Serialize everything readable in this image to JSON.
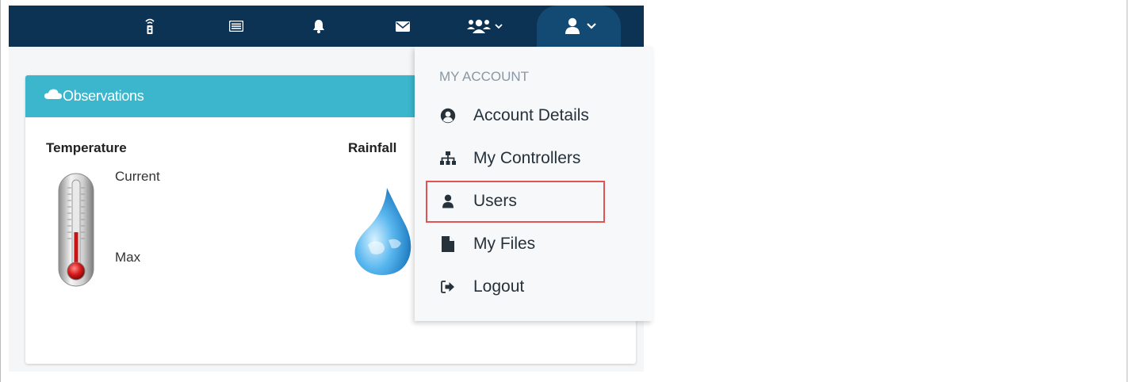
{
  "navbar": {
    "icons": [
      "remote-control-icon",
      "list-icon",
      "bell-icon",
      "envelope-icon",
      "users-icon",
      "user-icon"
    ],
    "background": "#0c3354",
    "active_pill": "#134a74"
  },
  "observations": {
    "title": "Observations",
    "header_color": "#3bb6cc",
    "temperature": {
      "heading": "Temperature",
      "current_label": "Current",
      "max_label": "Max"
    },
    "rainfall": {
      "heading": "Rainfall"
    }
  },
  "account_menu": {
    "header": "MY ACCOUNT",
    "items": [
      {
        "label": "Account Details",
        "icon": "user-circle-icon"
      },
      {
        "label": "My Controllers",
        "icon": "sitemap-icon"
      },
      {
        "label": "Users",
        "icon": "user-icon",
        "highlighted": true
      },
      {
        "label": "My Files",
        "icon": "file-icon"
      },
      {
        "label": "Logout",
        "icon": "sign-out-icon"
      }
    ],
    "highlight_color": "#e05454"
  }
}
